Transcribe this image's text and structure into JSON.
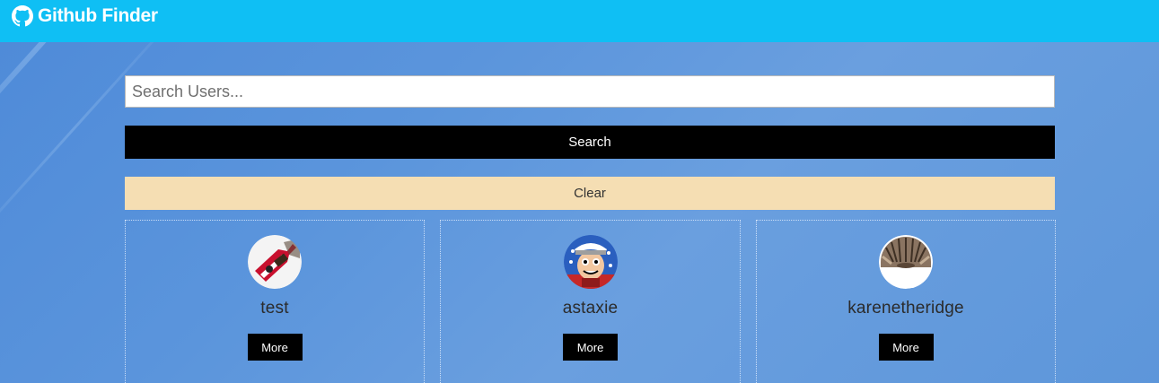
{
  "navbar": {
    "brand_text": "Github Finder",
    "brand_icon": "github-icon",
    "background_color": "#0fbff4"
  },
  "search": {
    "placeholder": "Search Users...",
    "value": "",
    "search_label": "Search",
    "clear_label": "Clear"
  },
  "users": [
    {
      "login": "test",
      "more_label": "More",
      "avatar_icon": "avatar-guitar"
    },
    {
      "login": "astaxie",
      "more_label": "More",
      "avatar_icon": "avatar-cartoon"
    },
    {
      "login": "karenetheridge",
      "more_label": "More",
      "avatar_icon": "avatar-cat"
    }
  ],
  "colors": {
    "search_button": "#000000",
    "clear_button": "#f5deb3",
    "more_button": "#000000"
  }
}
